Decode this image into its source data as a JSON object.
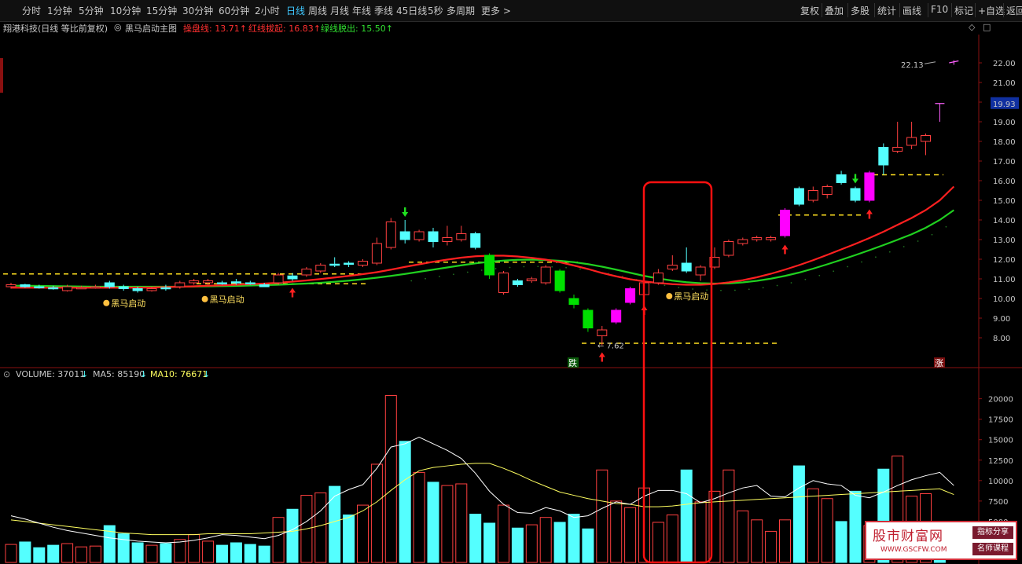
{
  "toolbar": {
    "periods": [
      "分时",
      "1分钟",
      "5分钟",
      "10分钟",
      "15分钟",
      "30分钟",
      "60分钟",
      "2小时",
      "日线",
      "周线",
      "月线",
      "年线",
      "季线",
      "45日线",
      "5秒",
      "多周期",
      "更多 >"
    ],
    "active_period": "日线",
    "right_buttons": [
      "复权",
      "叠加",
      "多股",
      "统计",
      "画线",
      "F10",
      "标记",
      "+自选",
      "返回"
    ]
  },
  "info": {
    "stock_title": "翔港科技(日线 等比前复权)",
    "indicator_name": "黑马启动主图",
    "line1_label": "操盘线: 13.71↑",
    "line2_label": "红线拔起: 16.83↑",
    "line3_label": "绿线脱出: 15.50↑"
  },
  "price_axis": {
    "ticks": [
      "22.00",
      "21.00",
      "20.00",
      "19.00",
      "18.00",
      "17.00",
      "16.00",
      "15.00",
      "14.00",
      "13.00",
      "12.00",
      "11.00",
      "10.00",
      "9.00",
      "8.00"
    ],
    "current_price": "19.93",
    "high_label": "22.13",
    "low_label": "7.62",
    "rise_marker": "涨",
    "fall_marker": "跌",
    "signal_label": "黑马启动"
  },
  "volume": {
    "title": "VOLUME: 37011",
    "ma5": "MA5: 85190",
    "ma10": "MA10: 76671",
    "arrow": "↓",
    "ticks": [
      "20000",
      "17500",
      "15000",
      "12500",
      "10000",
      "7500",
      "5000"
    ]
  },
  "watermark": {
    "title": "股市财富网",
    "url": "WWW.GSCFW.COM",
    "tag1": "指标分享",
    "tag2": "名师课程"
  },
  "colors": {
    "up": "#ff4040",
    "down": "#54ffff",
    "magenta": "#ff00ff",
    "green": "#00e000",
    "red_line": "#ff2020",
    "green_line": "#20d020",
    "dash": "#ffe020",
    "ma5": "#ffffff",
    "ma10": "#ffff60"
  },
  "chart_data": {
    "type": "candlestick",
    "candles": [
      {
        "o": 10.6,
        "c": 10.7,
        "h": 10.8,
        "l": 10.5,
        "v": 2200,
        "k": "u"
      },
      {
        "o": 10.7,
        "c": 10.6,
        "h": 10.75,
        "l": 10.55,
        "v": 2500,
        "k": "d"
      },
      {
        "o": 10.6,
        "c": 10.55,
        "h": 10.7,
        "l": 10.5,
        "v": 1800,
        "k": "d"
      },
      {
        "o": 10.55,
        "c": 10.5,
        "h": 10.65,
        "l": 10.45,
        "v": 2100,
        "k": "d"
      },
      {
        "o": 10.4,
        "c": 10.6,
        "h": 10.7,
        "l": 10.35,
        "v": 2300,
        "k": "u"
      },
      {
        "o": 10.55,
        "c": 10.55,
        "h": 10.65,
        "l": 10.5,
        "v": 1900,
        "k": "u"
      },
      {
        "o": 10.55,
        "c": 10.6,
        "h": 10.7,
        "l": 10.5,
        "v": 2000,
        "k": "u"
      },
      {
        "o": 10.6,
        "c": 10.8,
        "h": 10.9,
        "l": 10.5,
        "v": 4500,
        "k": "d"
      },
      {
        "o": 10.6,
        "c": 10.5,
        "h": 10.7,
        "l": 10.4,
        "v": 3500,
        "k": "d"
      },
      {
        "o": 10.4,
        "c": 10.5,
        "h": 10.6,
        "l": 10.3,
        "v": 2400,
        "k": "d"
      },
      {
        "o": 10.4,
        "c": 10.5,
        "h": 10.6,
        "l": 10.35,
        "v": 2100,
        "k": "u"
      },
      {
        "o": 10.5,
        "c": 10.55,
        "h": 10.7,
        "l": 10.4,
        "v": 2300,
        "k": "d"
      },
      {
        "o": 10.6,
        "c": 10.8,
        "h": 10.9,
        "l": 10.5,
        "v": 2800,
        "k": "u"
      },
      {
        "o": 10.8,
        "c": 10.9,
        "h": 11.0,
        "l": 10.7,
        "v": 3400,
        "k": "u"
      },
      {
        "o": 10.9,
        "c": 10.8,
        "h": 11.0,
        "l": 10.7,
        "v": 2600,
        "k": "u"
      },
      {
        "o": 10.8,
        "c": 10.75,
        "h": 10.9,
        "l": 10.7,
        "v": 2100,
        "k": "d"
      },
      {
        "o": 10.8,
        "c": 10.85,
        "h": 11.0,
        "l": 10.7,
        "v": 2400,
        "k": "d"
      },
      {
        "o": 10.8,
        "c": 10.75,
        "h": 10.9,
        "l": 10.7,
        "v": 2200,
        "k": "d"
      },
      {
        "o": 10.7,
        "c": 10.6,
        "h": 10.8,
        "l": 10.6,
        "v": 2000,
        "k": "d"
      },
      {
        "o": 10.8,
        "c": 11.2,
        "h": 11.3,
        "l": 10.7,
        "v": 5500,
        "k": "u"
      },
      {
        "o": 11.0,
        "c": 11.15,
        "h": 11.3,
        "l": 10.9,
        "v": 6500,
        "k": "d"
      },
      {
        "o": 11.2,
        "c": 11.5,
        "h": 11.6,
        "l": 11.1,
        "v": 8200,
        "k": "u"
      },
      {
        "o": 11.4,
        "c": 11.7,
        "h": 11.8,
        "l": 11.3,
        "v": 8500,
        "k": "u"
      },
      {
        "o": 11.75,
        "c": 11.7,
        "h": 12.1,
        "l": 11.6,
        "v": 9300,
        "k": "d"
      },
      {
        "o": 11.8,
        "c": 11.75,
        "h": 11.9,
        "l": 11.6,
        "v": 5800,
        "k": "d"
      },
      {
        "o": 11.7,
        "c": 11.9,
        "h": 12.0,
        "l": 11.6,
        "v": 7000,
        "k": "u"
      },
      {
        "o": 11.8,
        "c": 12.8,
        "h": 13.1,
        "l": 11.7,
        "v": 12000,
        "k": "u"
      },
      {
        "o": 12.6,
        "c": 13.9,
        "h": 14.1,
        "l": 12.5,
        "v": 20400,
        "k": "u"
      },
      {
        "o": 13.4,
        "c": 13.0,
        "h": 14.0,
        "l": 12.8,
        "v": 14800,
        "k": "d"
      },
      {
        "o": 13.0,
        "c": 13.4,
        "h": 13.5,
        "l": 12.9,
        "v": 11000,
        "k": "u"
      },
      {
        "o": 13.4,
        "c": 12.9,
        "h": 13.6,
        "l": 12.6,
        "v": 9800,
        "k": "d"
      },
      {
        "o": 12.9,
        "c": 13.1,
        "h": 13.7,
        "l": 12.7,
        "v": 9400,
        "k": "u"
      },
      {
        "o": 13.0,
        "c": 13.3,
        "h": 13.7,
        "l": 12.9,
        "v": 9600,
        "k": "u"
      },
      {
        "o": 13.3,
        "c": 12.6,
        "h": 13.4,
        "l": 12.5,
        "v": 5900,
        "k": "d"
      },
      {
        "o": 12.2,
        "c": 11.2,
        "h": 12.3,
        "l": 11.0,
        "v": 4800,
        "k": "g"
      },
      {
        "o": 11.3,
        "c": 10.3,
        "h": 11.4,
        "l": 10.2,
        "v": 7000,
        "k": "u"
      },
      {
        "o": 10.7,
        "c": 10.9,
        "h": 11.0,
        "l": 10.6,
        "v": 4200,
        "k": "d"
      },
      {
        "o": 11.0,
        "c": 10.9,
        "h": 11.1,
        "l": 10.8,
        "v": 4600,
        "k": "u"
      },
      {
        "o": 10.8,
        "c": 11.6,
        "h": 11.7,
        "l": 10.7,
        "v": 5500,
        "k": "u"
      },
      {
        "o": 11.4,
        "c": 10.4,
        "h": 11.5,
        "l": 10.3,
        "v": 4900,
        "k": "g"
      },
      {
        "o": 10.0,
        "c": 9.7,
        "h": 10.2,
        "l": 9.5,
        "v": 5900,
        "k": "g"
      },
      {
        "o": 9.4,
        "c": 8.5,
        "h": 9.5,
        "l": 8.3,
        "v": 4100,
        "k": "g"
      },
      {
        "o": 8.1,
        "c": 8.4,
        "h": 8.6,
        "l": 7.62,
        "v": 11300,
        "k": "u"
      },
      {
        "o": 8.8,
        "c": 9.4,
        "h": 9.5,
        "l": 8.7,
        "v": 7500,
        "k": "m"
      },
      {
        "o": 9.8,
        "c": 10.5,
        "h": 10.6,
        "l": 9.7,
        "v": 6700,
        "k": "m"
      },
      {
        "o": 10.2,
        "c": 10.8,
        "h": 11.0,
        "l": 10.0,
        "v": 9100,
        "k": "u"
      },
      {
        "o": 10.8,
        "c": 11.3,
        "h": 11.5,
        "l": 10.7,
        "v": 4900,
        "k": "u"
      },
      {
        "o": 11.5,
        "c": 11.7,
        "h": 12.2,
        "l": 11.4,
        "v": 5800,
        "k": "u"
      },
      {
        "o": 11.8,
        "c": 11.4,
        "h": 12.6,
        "l": 11.3,
        "v": 11300,
        "k": "d"
      },
      {
        "o": 11.2,
        "c": 11.6,
        "h": 11.7,
        "l": 10.9,
        "v": 7400,
        "k": "u"
      },
      {
        "o": 11.6,
        "c": 12.1,
        "h": 12.6,
        "l": 11.5,
        "v": 8700,
        "k": "u"
      },
      {
        "o": 12.2,
        "c": 12.9,
        "h": 13.0,
        "l": 12.1,
        "v": 11300,
        "k": "u"
      },
      {
        "o": 12.8,
        "c": 13.0,
        "h": 13.1,
        "l": 12.7,
        "v": 6300,
        "k": "u"
      },
      {
        "o": 13.0,
        "c": 13.1,
        "h": 13.2,
        "l": 12.9,
        "v": 5200,
        "k": "u"
      },
      {
        "o": 13.0,
        "c": 13.1,
        "h": 13.2,
        "l": 12.9,
        "v": 3800,
        "k": "u"
      },
      {
        "o": 13.2,
        "c": 14.5,
        "h": 14.6,
        "l": 13.1,
        "v": 5200,
        "k": "m"
      },
      {
        "o": 14.8,
        "c": 15.6,
        "h": 15.7,
        "l": 14.7,
        "v": 11800,
        "k": "d"
      },
      {
        "o": 15.0,
        "c": 15.5,
        "h": 15.7,
        "l": 14.9,
        "v": 9000,
        "k": "u"
      },
      {
        "o": 15.3,
        "c": 15.7,
        "h": 15.8,
        "l": 15.1,
        "v": 7800,
        "k": "u"
      },
      {
        "o": 15.9,
        "c": 16.3,
        "h": 16.5,
        "l": 15.8,
        "v": 5000,
        "k": "d"
      },
      {
        "o": 15.6,
        "c": 15.0,
        "h": 15.7,
        "l": 14.9,
        "v": 8700,
        "k": "d"
      },
      {
        "o": 15.0,
        "c": 16.4,
        "h": 16.5,
        "l": 14.9,
        "v": 4500,
        "k": "m"
      },
      {
        "o": 16.8,
        "c": 17.7,
        "h": 17.9,
        "l": 16.3,
        "v": 11400,
        "k": "d"
      },
      {
        "o": 17.5,
        "c": 17.7,
        "h": 19.0,
        "l": 17.4,
        "v": 13000,
        "k": "u"
      },
      {
        "o": 17.8,
        "c": 18.2,
        "h": 19.0,
        "l": 17.6,
        "v": 8100,
        "k": "u"
      },
      {
        "o": 18.0,
        "c": 18.3,
        "h": 18.4,
        "l": 17.3,
        "v": 8400,
        "k": "u"
      },
      {
        "o": 19.93,
        "c": 19.93,
        "h": 19.93,
        "l": 19.0,
        "v": 3700,
        "k": "x"
      },
      {
        "o": 22.0,
        "c": 22.1,
        "h": 22.13,
        "l": 21.9,
        "v": 0,
        "k": "x"
      }
    ],
    "red_line": [
      10.55,
      10.55,
      10.55,
      10.55,
      10.55,
      10.55,
      10.55,
      10.55,
      10.55,
      10.55,
      10.56,
      10.58,
      10.6,
      10.62,
      10.65,
      10.67,
      10.7,
      10.73,
      10.76,
      10.8,
      10.86,
      10.92,
      10.99,
      11.07,
      11.15,
      11.24,
      11.34,
      11.47,
      11.61,
      11.74,
      11.87,
      11.98,
      12.08,
      12.15,
      12.18,
      12.18,
      12.14,
      12.07,
      11.98,
      11.85,
      11.68,
      11.5,
      11.3,
      11.13,
      10.98,
      10.87,
      10.79,
      10.73,
      10.7,
      10.7,
      10.74,
      10.82,
      10.93,
      11.08,
      11.26,
      11.47,
      11.7,
      11.95,
      12.22,
      12.5,
      12.78,
      13.08,
      13.4,
      13.75,
      14.1,
      14.5,
      15.0,
      15.7
    ],
    "green_line": [
      10.65,
      10.65,
      10.64,
      10.63,
      10.62,
      10.61,
      10.6,
      10.6,
      10.6,
      10.6,
      10.6,
      10.6,
      10.6,
      10.61,
      10.62,
      10.63,
      10.64,
      10.66,
      10.68,
      10.7,
      10.73,
      10.76,
      10.8,
      10.85,
      10.91,
      10.98,
      11.06,
      11.15,
      11.25,
      11.36,
      11.47,
      11.58,
      11.69,
      11.79,
      11.87,
      11.93,
      11.97,
      11.98,
      11.96,
      11.92,
      11.85,
      11.75,
      11.62,
      11.47,
      11.31,
      11.15,
      11.02,
      10.91,
      10.83,
      10.78,
      10.76,
      10.77,
      10.82,
      10.9,
      11.01,
      11.15,
      11.32,
      11.52,
      11.74,
      11.97,
      12.21,
      12.46,
      12.72,
      12.99,
      13.27,
      13.6,
      14.0,
      14.5
    ],
    "ma5": [
      5700,
      5300,
      4800,
      4300,
      3900,
      3600,
      3300,
      3000,
      2800,
      2600,
      2500,
      2400,
      2500,
      2700,
      3000,
      3400,
      3300,
      3100,
      2900,
      3300,
      4000,
      5000,
      6300,
      8100,
      8900,
      9500,
      11500,
      14100,
      14500,
      15300,
      14500,
      13700,
      12700,
      10900,
      8700,
      7100,
      6100,
      6000,
      6700,
      6300,
      5500,
      5700,
      6600,
      7400,
      7100,
      8100,
      8800,
      8800,
      8400,
      7300,
      7800,
      8500,
      9100,
      9400,
      8100,
      8000,
      9100,
      10000,
      9600,
      9400,
      8200,
      7900,
      8600,
      9400,
      10100,
      10600,
      11000,
      9400
    ],
    "ma10": [
      5200,
      5000,
      4800,
      4600,
      4400,
      4200,
      4000,
      3800,
      3600,
      3500,
      3400,
      3400,
      3400,
      3400,
      3500,
      3500,
      3500,
      3500,
      3600,
      3700,
      3800,
      4100,
      4500,
      5000,
      5500,
      6300,
      7400,
      8800,
      10100,
      11200,
      11600,
      11800,
      12000,
      12100,
      12100,
      11500,
      10800,
      10000,
      9300,
      8600,
      8200,
      7800,
      7500,
      7200,
      7100,
      6800,
      6800,
      6900,
      7100,
      7300,
      7400,
      7500,
      7600,
      7700,
      7800,
      7900,
      8000,
      8100,
      8200,
      8300,
      8400,
      8500,
      8600,
      8700,
      8800,
      8900,
      9000,
      8300
    ],
    "ylim": [
      7.2,
      22.8
    ],
    "vol_ylim": [
      0,
      21500
    ]
  }
}
